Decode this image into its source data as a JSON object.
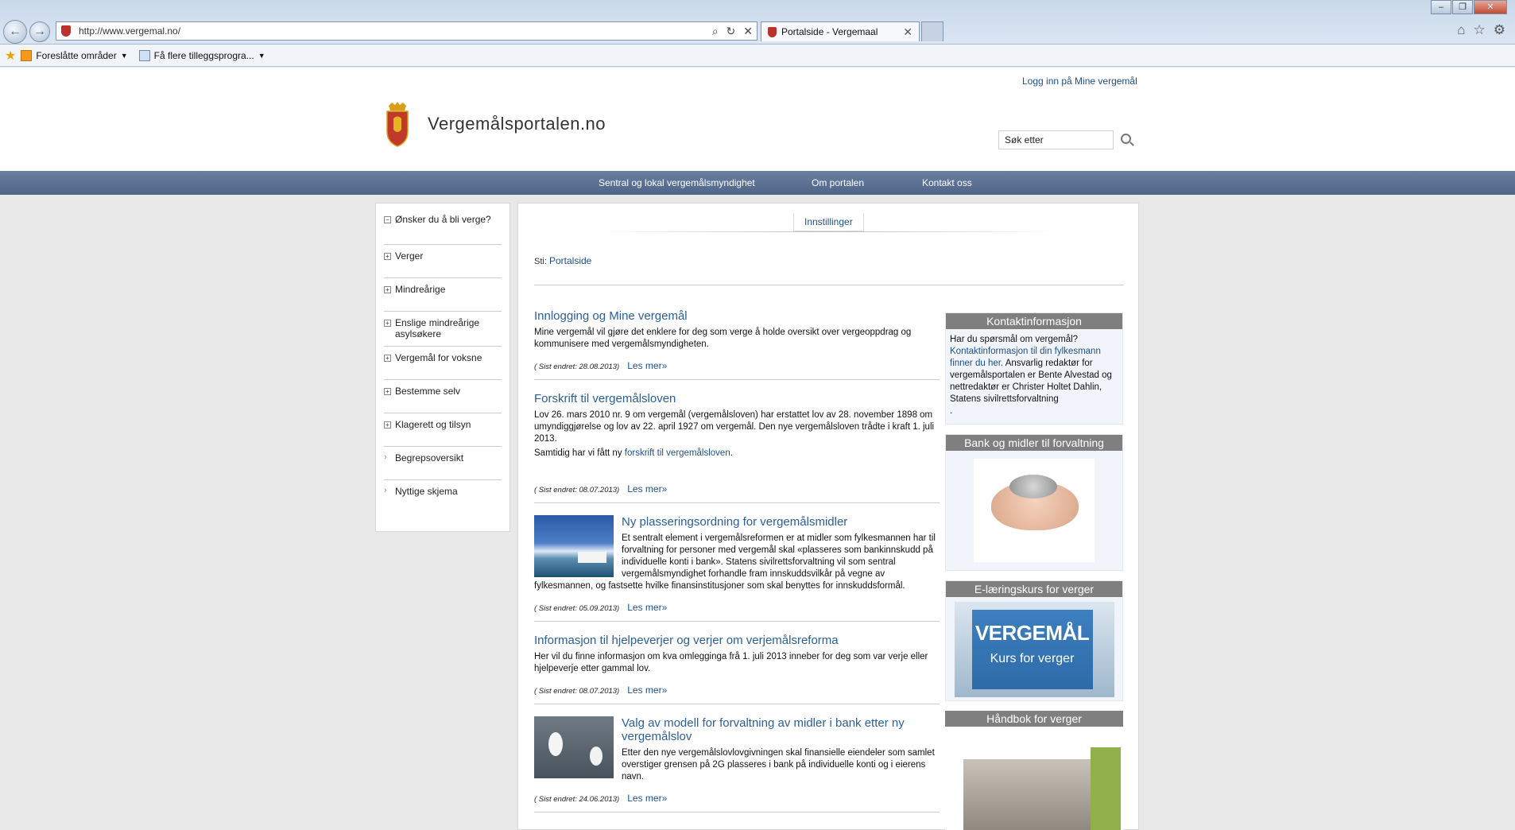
{
  "browser": {
    "url": "http://www.vergemal.no/",
    "tab_title": "Portalside - Vergemaal",
    "favorites": [
      {
        "label": "Foreslåtte områder"
      },
      {
        "label": "Få flere tilleggsprogra..."
      }
    ]
  },
  "header": {
    "login_link": "Logg inn på Mine vergemål",
    "site_name": "Vergemålsportalen.no",
    "search_value": "Søk etter"
  },
  "menu": {
    "items": [
      "Sentral og lokal vergemålsmyndighet",
      "Om portalen",
      "Kontakt oss"
    ]
  },
  "sidenav": {
    "items": [
      {
        "label": "Ønsker du å bli verge?",
        "toggle": "−"
      },
      {
        "label": "Verger",
        "toggle": "+"
      },
      {
        "label": "Mindreårige",
        "toggle": "+"
      },
      {
        "label": "Enslige mindreårige asylsøkere",
        "toggle": "+"
      },
      {
        "label": "Vergemål for voksne",
        "toggle": "+"
      },
      {
        "label": "Bestemme selv",
        "toggle": "+"
      },
      {
        "label": "Klagerett og tilsyn",
        "toggle": "+"
      },
      {
        "label": "Begrepsoversikt",
        "toggle": "›"
      },
      {
        "label": "Nyttige skjema",
        "toggle": "›"
      }
    ]
  },
  "content": {
    "settings_tab": "Innstillinger",
    "breadcrumb_prefix": "Sti:",
    "breadcrumb_link": "Portalside",
    "read_more": "Les mer»",
    "articles": [
      {
        "title": "Innlogging og Mine vergemål",
        "body": "Mine vergemål vil gjøre det enklere for deg som verge å holde oversikt over vergeoppdrag og kommunisere med vergemålsmyndigheten.",
        "updated": "( Sist endret: 28.08.2013)"
      },
      {
        "title": "Forskrift til vergemålsloven",
        "body": "Lov 26. mars 2010 nr. 9 om vergemål (vergemålsloven) har erstattet lov av 28. november 1898 om umyndiggjørelse og lov av 22. april 1927 om vergemål. Den nye vergemålsloven trådte i kraft 1. juli 2013.",
        "body2_prefix": "Samtidig har vi fått ny ",
        "body2_link": "forskrift til vergemålsloven",
        "body2_suffix": ".",
        "updated": "( Sist endret: 08.07.2013)"
      },
      {
        "title": "Ny plasseringsordning for vergemålsmidler",
        "body": "Et sentralt element i vergemålsreformen er at midler som fylkesmannen har til forvaltning for personer med vergemål skal «plasseres som bankinnskudd på individuelle konti i bank». Statens sivilrettsforvaltning vil som sentral vergemålsmyndighet forhandle fram innskuddsvilkår på vegne av fylkesmannen, og fastsette hvilke finansinstitusjoner som skal benyttes for innskuddsformål.",
        "updated": "( Sist endret: 05.09.2013)"
      },
      {
        "title": "Informasjon til hjelpeverjer og verjer om verjemålsreforma",
        "body": "Her vil du finne informasjon om kva omlegginga frå 1. juli 2013 inneber for deg som var verje eller hjelpeverje etter gammal lov.",
        "updated": "( Sist endret: 08.07.2013)"
      },
      {
        "title": "Valg av modell for forvaltning av midler i bank etter ny vergemålslov",
        "body": "Etter den nye vergemålslovlovgivningen skal finansielle eiendeler som samlet overstiger grensen på 2G plasseres i bank på individuelle konti og i eierens navn.",
        "updated": "( Sist endret: 24.06.2013)"
      }
    ]
  },
  "sidebar": {
    "contact": {
      "title": "Kontaktinformasjon",
      "question": "Har du spørsmål om vergemål?",
      "link": "Kontaktinformasjon til din fylkesmann finner du her.",
      "text": "Ansvarlig redaktør for vergemålsportalen er Bente Alvestad og nettredaktør er Christer Holtet Dahlin, Statens sivilrettsforvaltning",
      "trailing": "."
    },
    "bank": {
      "title": "Bank og midler til forvaltning"
    },
    "elearning": {
      "title": "E-læringskurs for verger",
      "image_title": "VERGEMÅL",
      "image_subtitle": "Kurs for verger"
    },
    "handbook": {
      "title": "Håndbok for verger"
    }
  }
}
